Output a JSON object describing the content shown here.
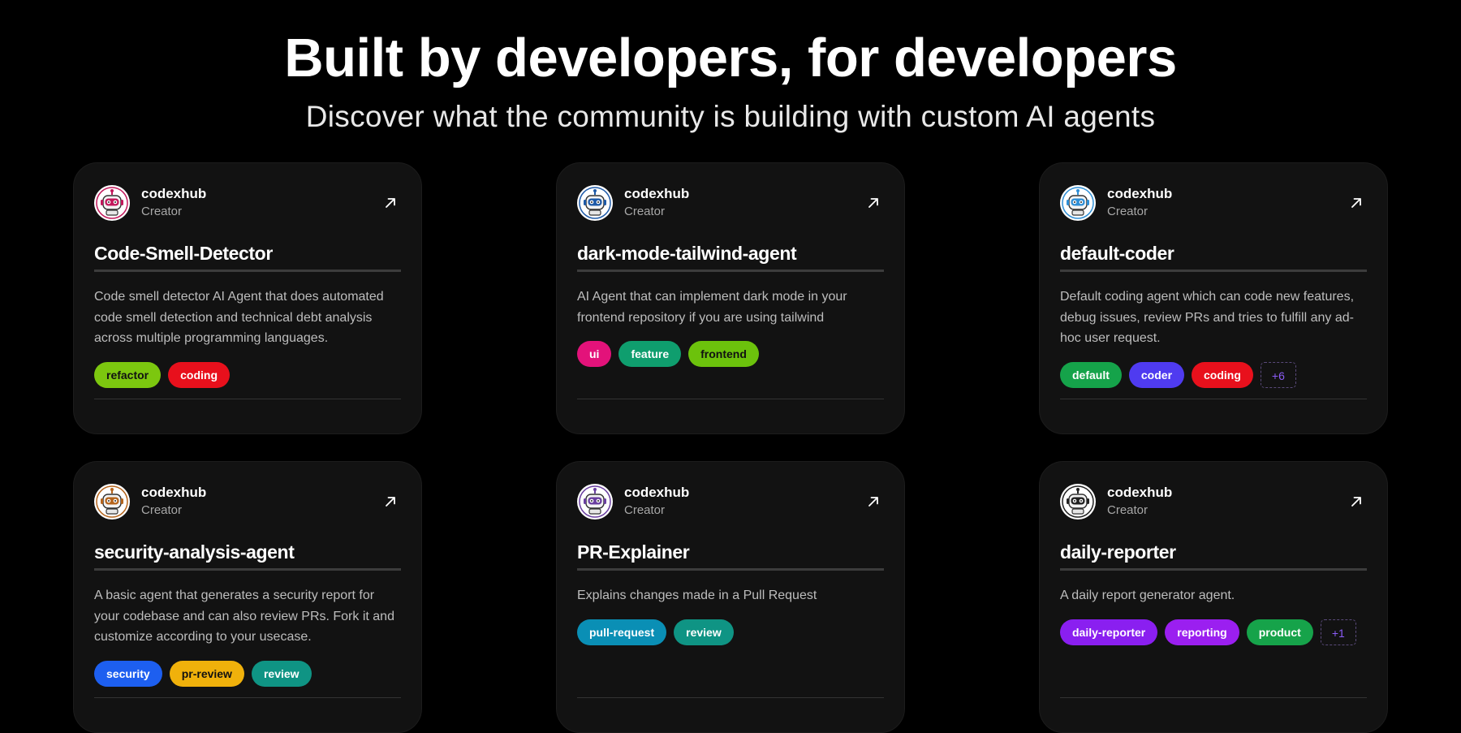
{
  "hero": {
    "title": "Built by developers, for developers",
    "subtitle": "Discover what the community is building with custom AI agents"
  },
  "cards": [
    {
      "creator_name": "codexhub",
      "creator_role": "Creator",
      "avatar_color": "#c2185b",
      "title": "Code-Smell-Detector",
      "description": "Code smell detector AI Agent that does automated code smell detection and technical debt analysis across multiple programming languages.",
      "tags": [
        {
          "label": "refactor",
          "color": "#7cc70f",
          "text": "dark"
        },
        {
          "label": "coding",
          "color": "#e8101c",
          "text": "light"
        }
      ],
      "more": ""
    },
    {
      "creator_name": "codexhub",
      "creator_role": "Creator",
      "avatar_color": "#1e5aa8",
      "title": "dark-mode-tailwind-agent",
      "description": "AI Agent that can implement dark mode in your frontend repository if you are using tailwind",
      "tags": [
        {
          "label": "ui",
          "color": "#e3127a",
          "text": "light"
        },
        {
          "label": "feature",
          "color": "#0f9e6e",
          "text": "light"
        },
        {
          "label": "frontend",
          "color": "#6cc20c",
          "text": "dark"
        }
      ],
      "more": ""
    },
    {
      "creator_name": "codexhub",
      "creator_role": "Creator",
      "avatar_color": "#2f8fd6",
      "title": "default-coder",
      "description": "Default coding agent which can code new features, debug issues, review PRs and tries to fulfill any ad-hoc user request.",
      "tags": [
        {
          "label": "default",
          "color": "#15a34a",
          "text": "light"
        },
        {
          "label": "coder",
          "color": "#4f3bf0",
          "text": "light"
        },
        {
          "label": "coding",
          "color": "#e8101c",
          "text": "light"
        }
      ],
      "more": "+6"
    },
    {
      "creator_name": "codexhub",
      "creator_role": "Creator",
      "avatar_color": "#b5651d",
      "title": "security-analysis-agent",
      "description": "A basic agent that generates a security report for your codebase and can also review PRs. Fork it and customize according to your usecase.",
      "tags": [
        {
          "label": "security",
          "color": "#1d5ff0",
          "text": "light"
        },
        {
          "label": "pr-review",
          "color": "#f0b10b",
          "text": "dark"
        },
        {
          "label": "review",
          "color": "#0f9484",
          "text": "light"
        }
      ],
      "more": ""
    },
    {
      "creator_name": "codexhub",
      "creator_role": "Creator",
      "avatar_color": "#6a3fa0",
      "title": "PR-Explainer",
      "description": "Explains changes made in a Pull Request",
      "tags": [
        {
          "label": "pull-request",
          "color": "#0a8fb5",
          "text": "light"
        },
        {
          "label": "review",
          "color": "#0f9484",
          "text": "light"
        }
      ],
      "more": ""
    },
    {
      "creator_name": "codexhub",
      "creator_role": "Creator",
      "avatar_color": "#222222",
      "title": "daily-reporter",
      "description": "A daily report generator agent.",
      "tags": [
        {
          "label": "daily-reporter",
          "color": "#8a1ff0",
          "text": "light"
        },
        {
          "label": "reporting",
          "color": "#9b1ff0",
          "text": "light"
        },
        {
          "label": "product",
          "color": "#16a34a",
          "text": "light"
        }
      ],
      "more": "+1"
    }
  ]
}
